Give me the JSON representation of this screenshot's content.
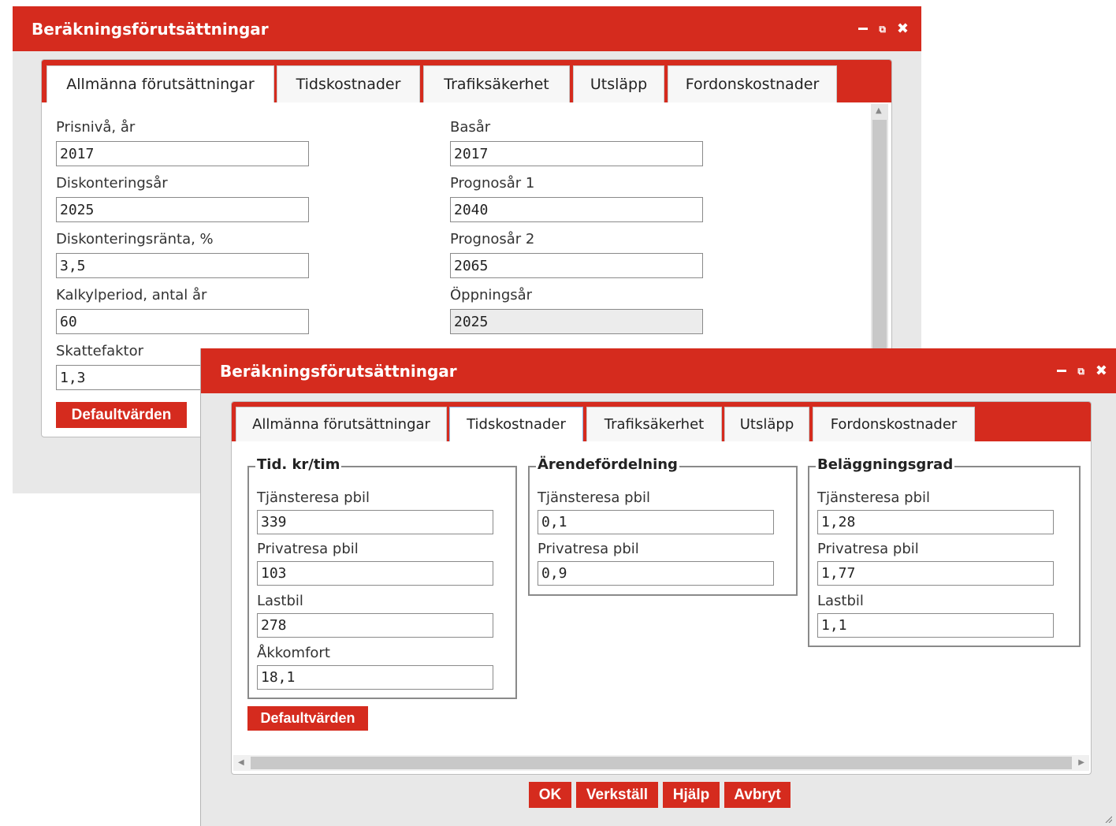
{
  "back_dialog": {
    "title": "Beräkningsförutsättningar",
    "tabs": [
      "Allmänna förutsättningar",
      "Tidskostnader",
      "Trafiksäkerhet",
      "Utsläpp",
      "Fordonskostnader"
    ],
    "active_tab": "Allmänna förutsättningar",
    "fields_left": [
      {
        "label": "Prisnivå, år",
        "value": "2017"
      },
      {
        "label": "Diskonteringsår",
        "value": "2025"
      },
      {
        "label": "Diskonteringsränta, %",
        "value": "3,5"
      },
      {
        "label": "Kalkylperiod, antal år",
        "value": "60"
      },
      {
        "label": "Skattefaktor",
        "value": "1,3"
      }
    ],
    "fields_right": [
      {
        "label": "Basår",
        "value": "2017"
      },
      {
        "label": "Prognosår 1",
        "value": "2040"
      },
      {
        "label": "Prognosår 2",
        "value": "2065"
      },
      {
        "label": "Öppningsår",
        "value": "2025"
      }
    ],
    "default_button": "Defaultvärden"
  },
  "front_dialog": {
    "title": "Beräkningsförutsättningar",
    "tabs": [
      "Allmänna förutsättningar",
      "Tidskostnader",
      "Trafiksäkerhet",
      "Utsläpp",
      "Fordonskostnader"
    ],
    "active_tab": "Tidskostnader",
    "groups": [
      {
        "legend": "Tid. kr/tim",
        "fields": [
          {
            "label": "Tjänsteresa pbil",
            "value": "339"
          },
          {
            "label": "Privatresa pbil",
            "value": "103"
          },
          {
            "label": "Lastbil",
            "value": "278"
          },
          {
            "label": "Åkkomfort",
            "value": "18,1"
          }
        ]
      },
      {
        "legend": "Ärendefördelning",
        "fields": [
          {
            "label": "Tjänsteresa pbil",
            "value": "0,1"
          },
          {
            "label": "Privatresa pbil",
            "value": "0,9"
          }
        ]
      },
      {
        "legend": "Beläggningsgrad",
        "fields": [
          {
            "label": "Tjänsteresa pbil",
            "value": "1,28"
          },
          {
            "label": "Privatresa pbil",
            "value": "1,77"
          },
          {
            "label": "Lastbil",
            "value": "1,1"
          }
        ]
      }
    ],
    "default_button": "Defaultvärden",
    "footer_buttons": {
      "ok": "OK",
      "apply": "Verkställ",
      "help": "Hjälp",
      "cancel": "Avbryt"
    }
  },
  "colors": {
    "accent": "#d52b1e",
    "panel_bg": "#ffffff",
    "dialog_bg": "#e8e8e8"
  },
  "window_icons": [
    "minimize-icon",
    "popout-icon",
    "close-icon"
  ]
}
